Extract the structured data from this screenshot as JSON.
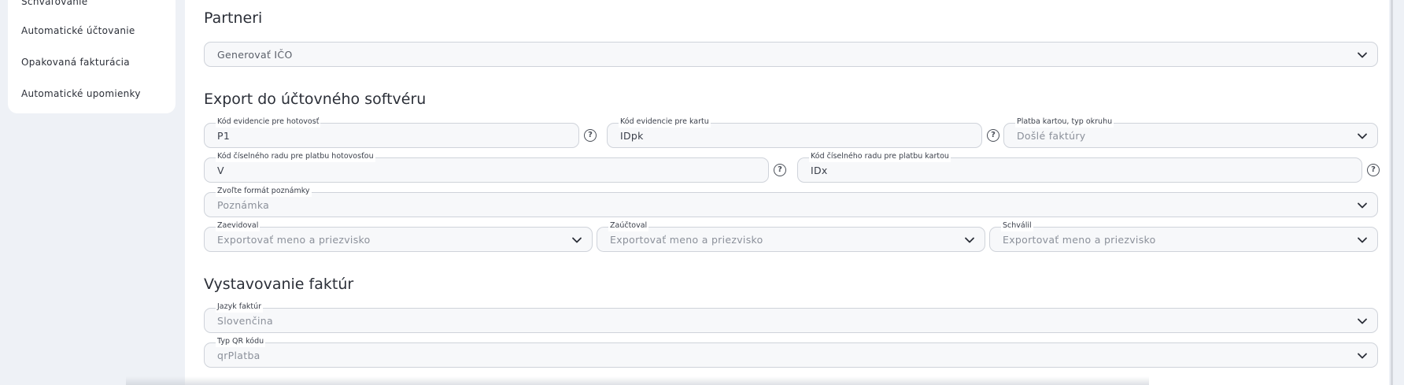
{
  "sidebar": {
    "items": [
      {
        "label": "Schvaľovanie"
      },
      {
        "label": "Automatické účtovanie"
      },
      {
        "label": "Opakovaná fakturácia"
      },
      {
        "label": "Automatické upomienky"
      }
    ]
  },
  "partners": {
    "title": "Partneri",
    "generate_ico": {
      "value": "Generovať IČO"
    }
  },
  "export": {
    "title": "Export do účtovného softvéru",
    "cash_code": {
      "label": "Kód evidencie pre hotovosť",
      "value": "P1"
    },
    "card_code": {
      "label": "Kód evidencie pre kartu",
      "value": "IDpk"
    },
    "card_payment_type": {
      "label": "Platba kartou, typ okruhu",
      "value": "Došlé faktúry"
    },
    "cash_series_code": {
      "label": "Kód číselného radu pre platbu hotovosťou",
      "value": "V"
    },
    "card_series_code": {
      "label": "Kód číselného radu pre platbu kartou",
      "value": "IDx"
    },
    "note_format": {
      "label": "Zvoľte formát poznámky",
      "value": "Poznámka"
    },
    "recorded_by": {
      "label": "Zaevidoval",
      "value": "Exportovať meno a priezvisko"
    },
    "posted_by": {
      "label": "Zaúčtoval",
      "value": "Exportovať meno a priezvisko"
    },
    "approved_by": {
      "label": "Schválil",
      "value": "Exportovať meno a priezvisko"
    }
  },
  "invoicing": {
    "title": "Vystavovanie faktúr",
    "language": {
      "label": "Jazyk faktúr",
      "value": "Slovenčina"
    },
    "qr_type": {
      "label": "Typ QR kódu",
      "value": "qrPlatba"
    }
  },
  "icons": {
    "help": "?"
  }
}
